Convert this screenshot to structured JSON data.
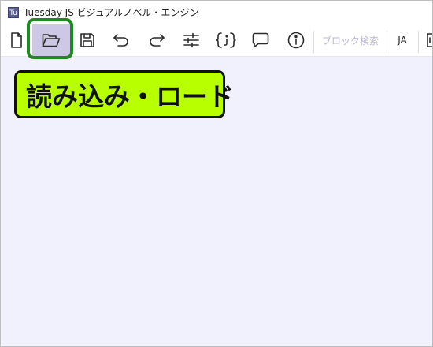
{
  "window": {
    "title": "Tuesday JS ビジュアルノベル・エンジン",
    "app_icon_text": "Tu"
  },
  "toolbar": {
    "buttons": [
      {
        "name": "new-file",
        "icon": "new-file-icon"
      },
      {
        "name": "open-folder",
        "icon": "folder-open-icon",
        "active": true
      },
      {
        "name": "save",
        "icon": "save-icon"
      },
      {
        "name": "undo",
        "icon": "undo-icon"
      },
      {
        "name": "redo",
        "icon": "redo-icon"
      },
      {
        "name": "settings",
        "icon": "sliders-icon"
      },
      {
        "name": "variables",
        "icon": "braces-icon"
      },
      {
        "name": "comment",
        "icon": "speech-bubble-icon"
      },
      {
        "name": "info",
        "icon": "info-icon"
      }
    ],
    "block_search_label": "ブロック検索",
    "language_label": "JA"
  },
  "callout": {
    "text": "読み込み・ロード"
  },
  "colors": {
    "canvas_background": "#f1f0fd",
    "active_button": "#cdc8e6",
    "highlight_border": "#1f8a1f",
    "callout_background": "#b8ff00",
    "block_search_text": "#b9b4d8"
  }
}
